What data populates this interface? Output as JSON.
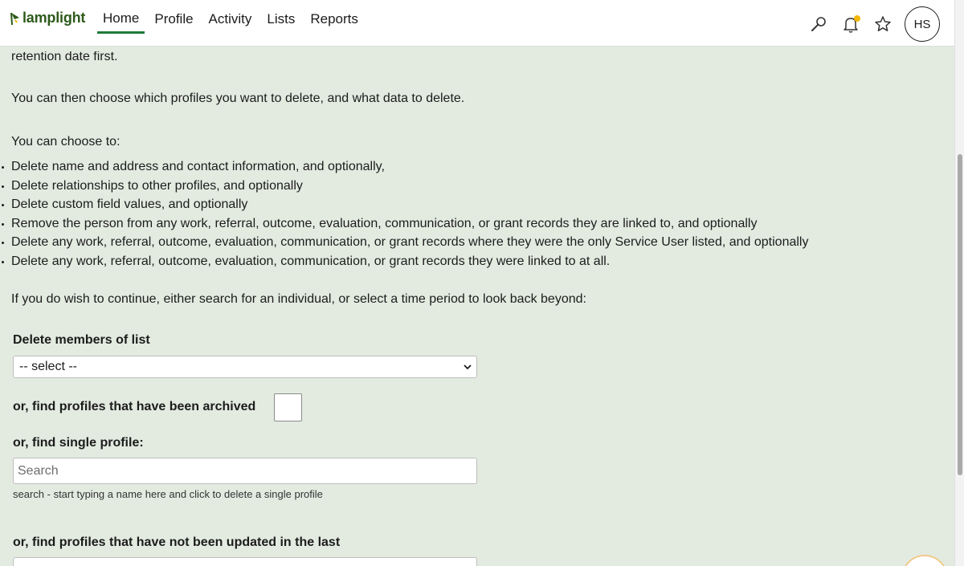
{
  "brand": {
    "name": "lamplight"
  },
  "nav": {
    "items": [
      {
        "label": "Home",
        "active": true
      },
      {
        "label": "Profile",
        "active": false
      },
      {
        "label": "Activity",
        "active": false
      },
      {
        "label": "Lists",
        "active": false
      },
      {
        "label": "Reports",
        "active": false
      }
    ]
  },
  "header": {
    "icons": [
      "search-icon",
      "bell-icon",
      "star-icon"
    ],
    "avatar_initials": "HS",
    "notification_color": "#f2b705"
  },
  "content": {
    "cut_line": "retention date first.",
    "intro": "You can then choose which profiles you want to delete, and what data to delete.",
    "choose_heading": "You can choose to:",
    "options": [
      "Delete name and address and contact information, and optionally,",
      "Delete relationships to other profiles, and optionally",
      "Delete custom field values, and optionally",
      "Remove the person from any work, referral, outcome, evaluation, communication, or grant records they are linked to, and optionally",
      "Delete any work, referral, outcome, evaluation, communication, or grant records where they were the only Service User listed, and optionally",
      "Delete any work, referral, outcome, evaluation, communication, or grant records they were linked to at all."
    ],
    "continue_text": "If you do wish to continue, either search for an individual, or select a time period to look back beyond:"
  },
  "form": {
    "list_label": "Delete members of list",
    "list_select_value": "-- select --",
    "archived_label": "or, find profiles that have been archived",
    "single_label": "or, find single profile:",
    "search_placeholder": "Search",
    "search_hint": "search - start typing a name here and click to delete a single profile",
    "not_updated_label": "or, find profiles that have not been updated in the last"
  },
  "colors": {
    "accent": "#1e7a3a",
    "background": "#e3ebe1"
  }
}
